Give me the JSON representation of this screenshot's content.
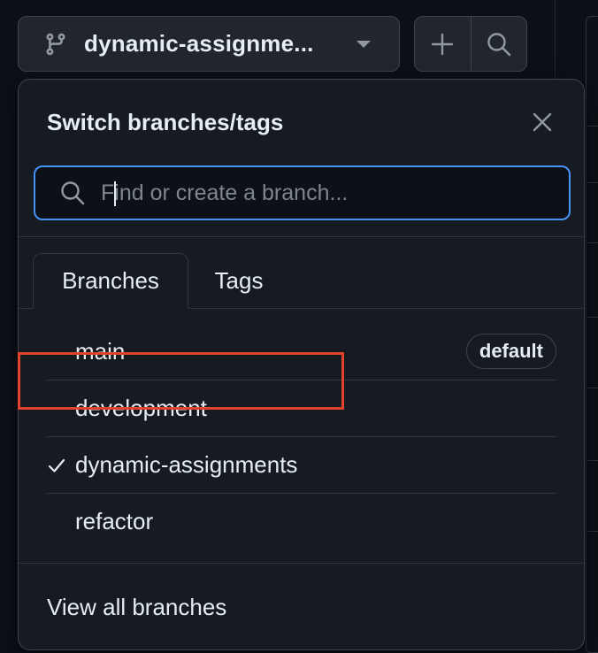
{
  "branch_selector": {
    "current_branch": "dynamic-assignme..."
  },
  "actions": {
    "add_icon": "plus-icon",
    "search_icon": "search-icon"
  },
  "dropdown": {
    "title": "Switch branches/tags",
    "close_icon": "close-icon",
    "search": {
      "placeholder": "Find or create a branch...",
      "value": ""
    },
    "tabs": [
      {
        "label": "Branches",
        "selected": true
      },
      {
        "label": "Tags",
        "selected": false
      }
    ],
    "branches": [
      {
        "name": "main",
        "badge": "default",
        "checked": false
      },
      {
        "name": "development",
        "badge": "",
        "checked": false
      },
      {
        "name": "dynamic-assignments",
        "badge": "",
        "checked": true
      },
      {
        "name": "refactor",
        "badge": "",
        "checked": false
      }
    ],
    "footer_link": "View all branches"
  },
  "colors": {
    "focus_border": "#4493f8",
    "annotation_highlight": "#e2432d",
    "panel_background": "#161b22"
  }
}
